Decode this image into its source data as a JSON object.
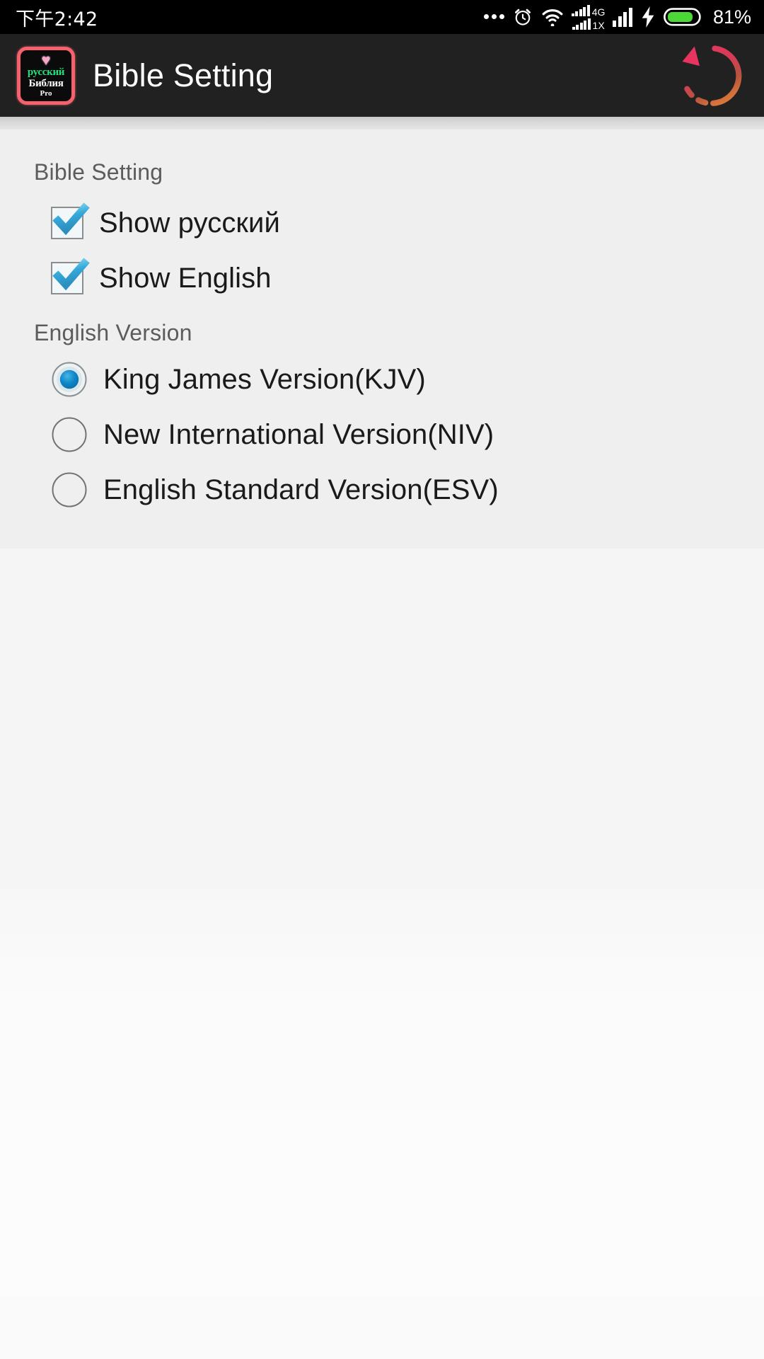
{
  "status_bar": {
    "clock": "下午2:42",
    "battery_percent": "81%",
    "network_labels": {
      "primary": "4G",
      "secondary": "1X"
    },
    "icons": [
      "more-dots-icon",
      "alarm-clock-icon",
      "wifi-icon",
      "dual-signal-icon",
      "signal-icon",
      "charging-bolt-icon",
      "battery-icon"
    ],
    "colors": {
      "background": "#000000",
      "foreground": "#ffffff",
      "battery_fill": "#4cd938"
    }
  },
  "action_bar": {
    "title": "Bible Setting",
    "app_icon": {
      "heart": "♥",
      "line1": "русский",
      "line2": "Библия",
      "line3": "Pro",
      "border_color": "#f4626e",
      "line1_color": "#27e07a"
    },
    "refresh_label": "refresh",
    "colors": {
      "background": "#212121",
      "title": "#ffffff",
      "refresh": "#e8355f"
    }
  },
  "settings": {
    "section1_title": "Bible Setting",
    "checkboxes": [
      {
        "label": "Show русский",
        "checked": true
      },
      {
        "label": "Show English",
        "checked": true
      }
    ],
    "section2_title": "English Version",
    "radios": [
      {
        "label": "King James Version(KJV)",
        "selected": true
      },
      {
        "label": "New International Version(NIV)",
        "selected": false
      },
      {
        "label": "English Standard Version(ESV)",
        "selected": false
      }
    ],
    "colors": {
      "panel_background": "#efefef",
      "section_header_text": "#5c5c5c",
      "item_text": "#1a1a1a",
      "check_accent": "#34a8d8",
      "radio_accent": "#0d85c8"
    }
  }
}
